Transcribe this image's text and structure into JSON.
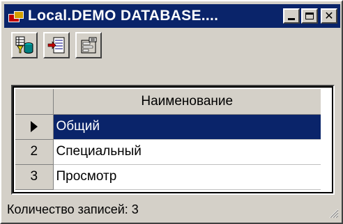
{
  "window": {
    "title": "Local.DEMO DATABASE....",
    "buttons": {
      "minimize": "",
      "maximize": "",
      "close": "✕"
    }
  },
  "toolbar": {
    "buttons": [
      {
        "icon": "database-filter-icon"
      },
      {
        "icon": "insert-record-icon"
      },
      {
        "icon": "properties-icon"
      }
    ]
  },
  "grid": {
    "columns": {
      "indicator": "",
      "name": "Наименование"
    },
    "rows": [
      {
        "num": "",
        "name": "Общий",
        "selected": true
      },
      {
        "num": "2",
        "name": "Специальный",
        "selected": false
      },
      {
        "num": "3",
        "name": "Просмотр",
        "selected": false
      }
    ]
  },
  "status": {
    "text": "Количество записей: 3"
  },
  "colors": {
    "titlebar": "#0a246a",
    "selection": "#0a246a",
    "face": "#d4d0c8"
  }
}
